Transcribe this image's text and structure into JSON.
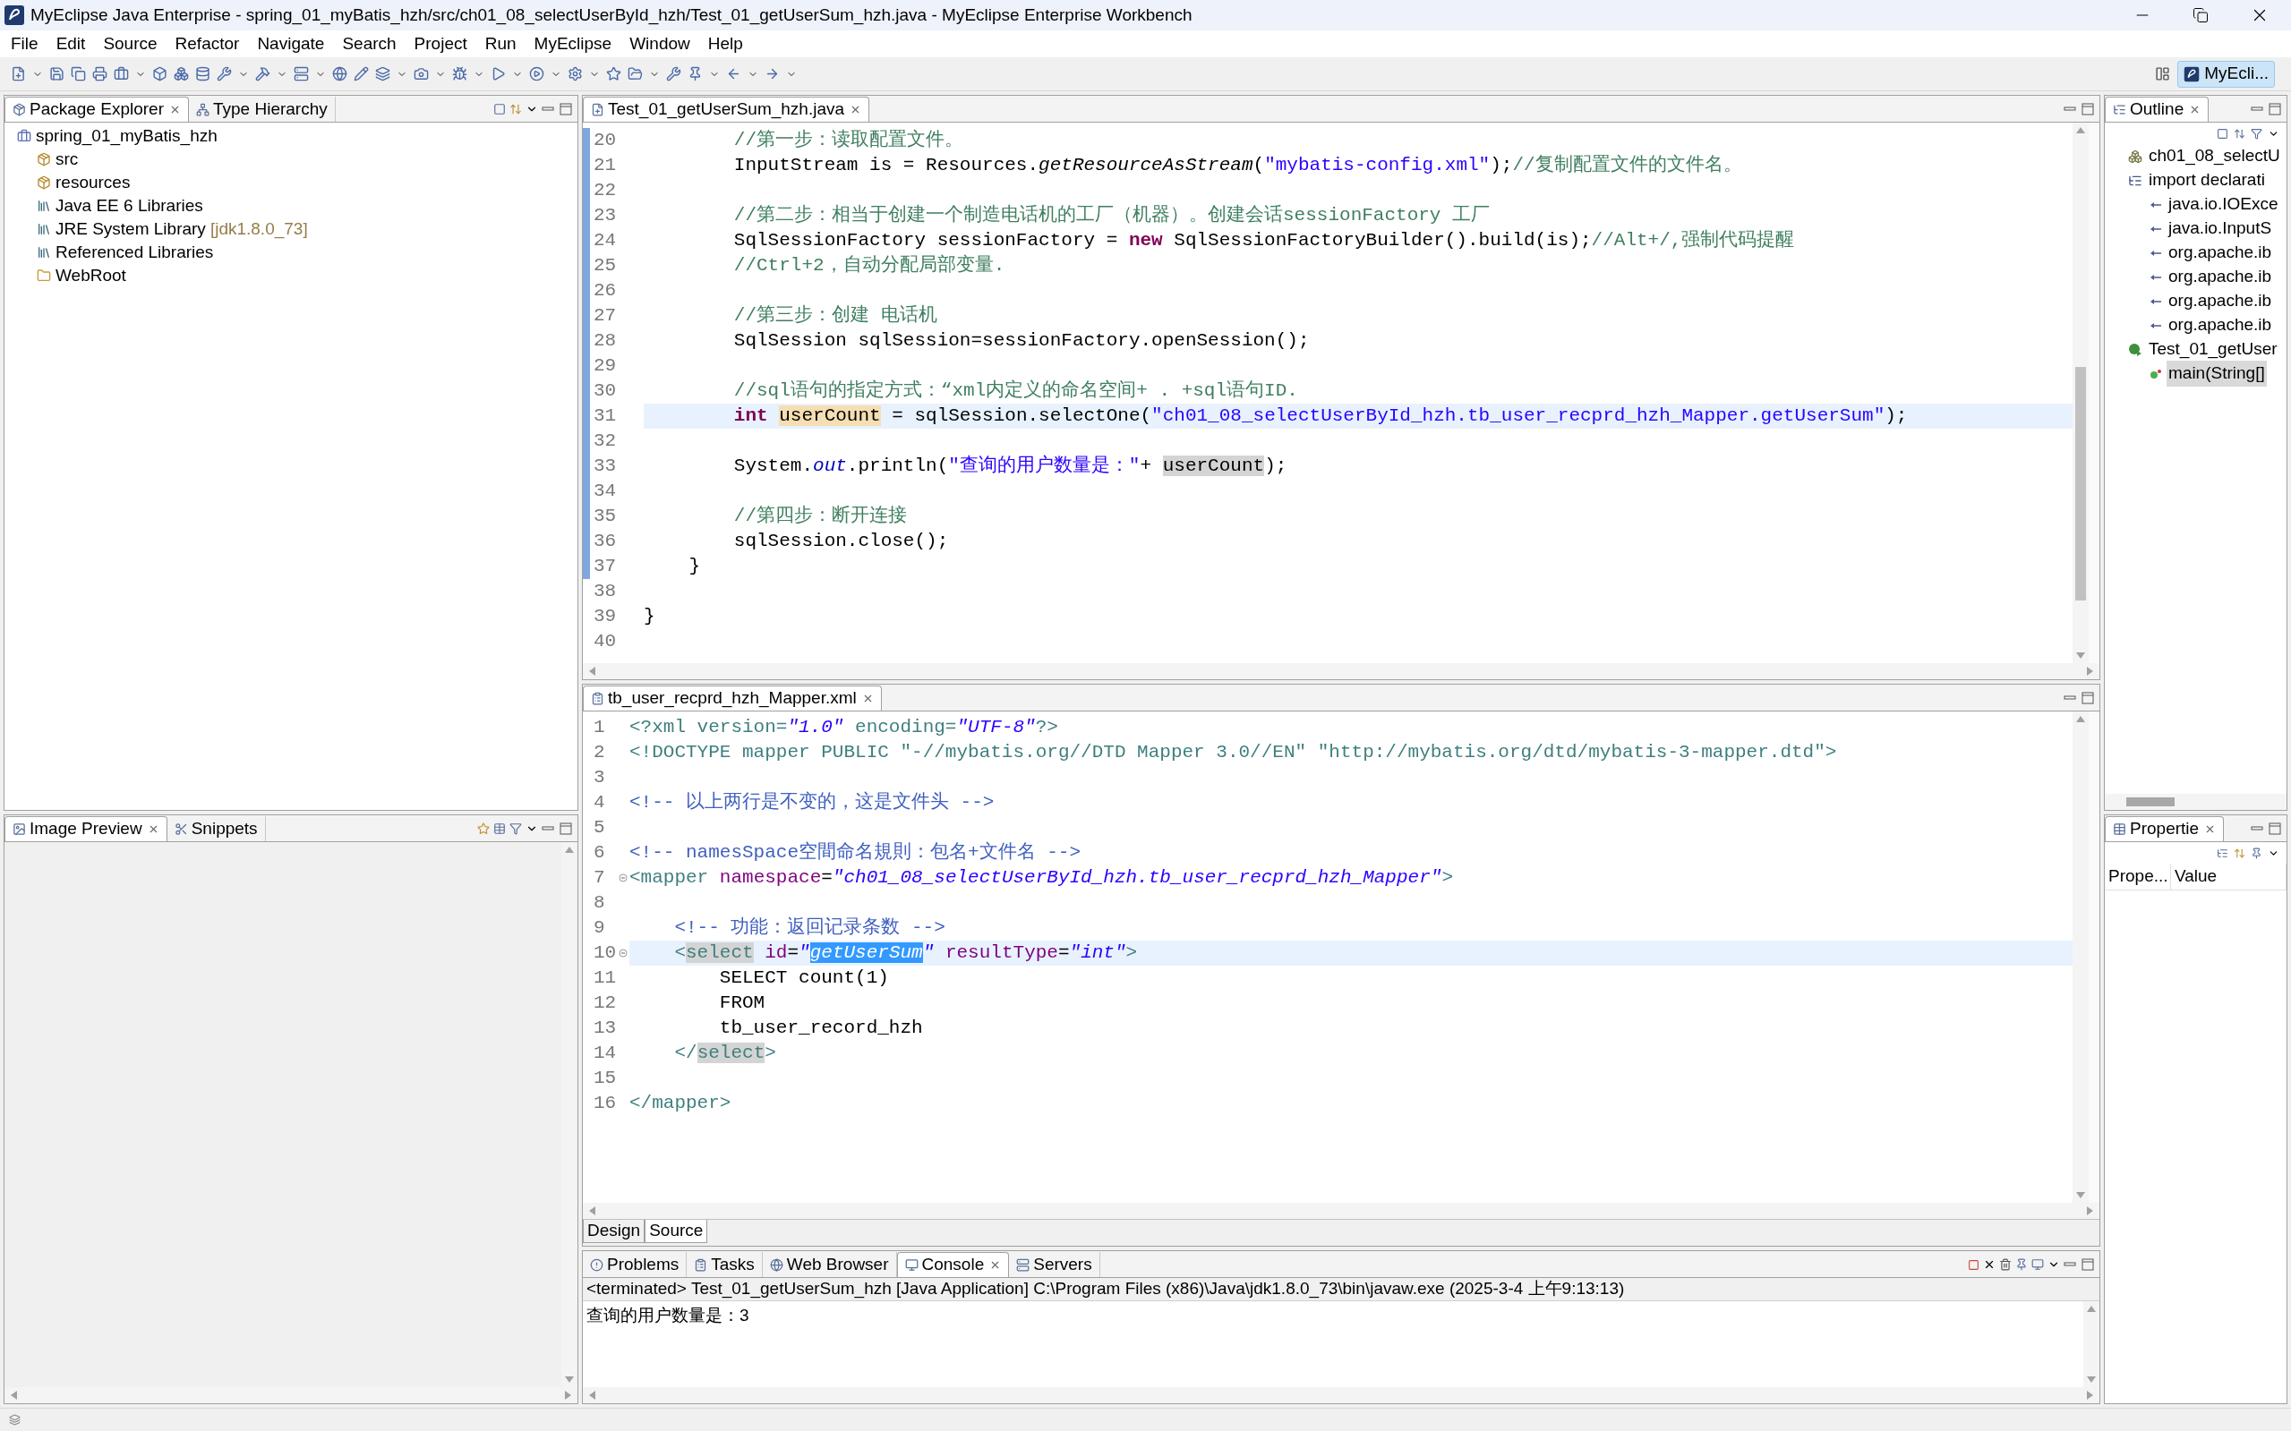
{
  "window": {
    "title": "MyEclipse Java Enterprise - spring_01_myBatis_hzh/src/ch01_08_selectUserById_hzh/Test_01_getUserSum_hzh.java - MyEclipse Enterprise Workbench"
  },
  "menu": [
    "File",
    "Edit",
    "Source",
    "Refactor",
    "Navigate",
    "Search",
    "Project",
    "Run",
    "MyEclipse",
    "Window",
    "Help"
  ],
  "perspective": {
    "label": "MyEcli...",
    "selected": true
  },
  "package_explorer": {
    "tabs": [
      {
        "label": "Package Explorer",
        "selected": true,
        "closable": true
      },
      {
        "label": "Type Hierarchy",
        "selected": false,
        "closable": false
      }
    ],
    "tree": [
      {
        "label": "spring_01_myBatis_hzh",
        "kind": "project",
        "children": [
          {
            "label": "src",
            "kind": "source"
          },
          {
            "label": "resources",
            "kind": "source"
          },
          {
            "label": "Java EE 6 Libraries",
            "kind": "library"
          },
          {
            "label": "JRE System Library",
            "decoration": "[jdk1.8.0_73]",
            "kind": "library"
          },
          {
            "label": "Referenced Libraries",
            "kind": "library"
          },
          {
            "label": "WebRoot",
            "kind": "folder"
          }
        ]
      }
    ]
  },
  "image_preview": {
    "tabs": [
      {
        "label": "Image Preview",
        "selected": true,
        "closable": true
      },
      {
        "label": "Snippets",
        "selected": false,
        "closable": false
      }
    ]
  },
  "java_editor": {
    "tab": {
      "label": "Test_01_getUserSum_hzh.java"
    },
    "lines": [
      {
        "num": "20",
        "current": false,
        "tokens": [
          {
            "t": "        //第一步：读取配置文件。",
            "kind": "comment"
          }
        ]
      },
      {
        "num": "21",
        "current": false,
        "tokens": [
          {
            "t": "        InputStream is = Resources.",
            "kind": "plain"
          },
          {
            "t": "getResourceAsStream",
            "kind": "method"
          },
          {
            "t": "(",
            "kind": "plain"
          },
          {
            "t": "\"mybatis-config.xml\"",
            "kind": "string"
          },
          {
            "t": ");",
            "kind": "plain"
          },
          {
            "t": "//复制配置文件的文件名。",
            "kind": "comment"
          }
        ]
      },
      {
        "num": "22",
        "current": false
      },
      {
        "num": "23",
        "current": false,
        "tokens": [
          {
            "t": "        //第二步：相当于创建一个制造电话机的工厂（机器）。创建会话sessionFactory 工厂",
            "kind": "comment"
          }
        ]
      },
      {
        "num": "24",
        "current": false,
        "tokens": [
          {
            "t": "        SqlSessionFactory sessionFactory = ",
            "kind": "plain"
          },
          {
            "t": "new",
            "kind": "keyword"
          },
          {
            "t": " SqlSessionFactoryBuilder().build(is);",
            "kind": "plain"
          },
          {
            "t": "//Alt+/,强制代码提醒",
            "kind": "comment"
          }
        ]
      },
      {
        "num": "25",
        "current": false,
        "tokens": [
          {
            "t": "        //Ctrl+2，自动分配局部变量.",
            "kind": "comment"
          }
        ]
      },
      {
        "num": "26",
        "current": false
      },
      {
        "num": "27",
        "current": false,
        "tokens": [
          {
            "t": "        //第三步：创建 电话机",
            "kind": "comment"
          }
        ]
      },
      {
        "num": "28",
        "current": false,
        "tokens": [
          {
            "t": "        SqlSession sqlSession=sessionFactory.openSession();",
            "kind": "plain"
          }
        ]
      },
      {
        "num": "29",
        "current": false
      },
      {
        "num": "30",
        "current": false,
        "tokens": [
          {
            "t": "        //sql语句的指定方式：“xml内定义的命名空间+ . +sql语句ID.",
            "kind": "comment"
          }
        ]
      },
      {
        "num": "31",
        "current": true,
        "tokens": [
          {
            "t": "        int ",
            "kind": "keyword"
          },
          {
            "t": "userCount",
            "kind": "occurrence"
          },
          {
            "t": " = sqlSession.selectOne(",
            "kind": "plain"
          },
          {
            "t": "\"ch01_08_selectUserById_hzh.tb_user_recprd_hzh_Mapper.getUserSum\"",
            "kind": "string"
          },
          {
            "t": ");",
            "kind": "plain"
          }
        ]
      },
      {
        "num": "32",
        "current": false
      },
      {
        "num": "33",
        "current": false,
        "tokens": [
          {
            "t": "        System.",
            "kind": "plain"
          },
          {
            "t": "out",
            "kind": "field"
          },
          {
            "t": ".println(",
            "kind": "plain"
          },
          {
            "t": "\"查询的用户数量是：\"",
            "kind": "string"
          },
          {
            "t": "+ ",
            "kind": "plain"
          },
          {
            "t": "userCount",
            "kind": "shade"
          },
          {
            "t": ");",
            "kind": "plain"
          }
        ]
      },
      {
        "num": "34",
        "current": false
      },
      {
        "num": "35",
        "current": false,
        "tokens": [
          {
            "t": "        //第四步：断开连接",
            "kind": "comment"
          }
        ]
      },
      {
        "num": "36",
        "current": false,
        "tokens": [
          {
            "t": "        sqlSession.close();",
            "kind": "plain"
          }
        ]
      },
      {
        "num": "37",
        "current": false,
        "tokens": [
          {
            "t": "    }",
            "kind": "plain"
          }
        ]
      },
      {
        "num": "38",
        "current": false
      },
      {
        "num": "39",
        "current": false,
        "tokens": [
          {
            "t": "}",
            "kind": "plain"
          }
        ]
      },
      {
        "num": "40",
        "current": false
      }
    ]
  },
  "xml_editor": {
    "tab": {
      "label": "tb_user_recprd_hzh_Mapper.xml"
    },
    "lines": [
      {
        "num": "1",
        "current": false,
        "fold": false,
        "tokens": [
          {
            "t": "<?xml version=",
            "kind": "tag"
          },
          {
            "t": "\"1.0\"",
            "kind": "value"
          },
          {
            "t": " encoding=",
            "kind": "tag"
          },
          {
            "t": "\"UTF-8\"",
            "kind": "value"
          },
          {
            "t": "?>",
            "kind": "tag"
          }
        ]
      },
      {
        "num": "2",
        "current": false,
        "fold": false,
        "tokens": [
          {
            "t": "<!DOCTYPE mapper PUBLIC \"-//mybatis.org//DTD Mapper 3.0//EN\" \"http://mybatis.org/dtd/mybatis-3-mapper.dtd\">",
            "kind": "tag"
          }
        ]
      },
      {
        "num": "3",
        "current": false,
        "fold": false
      },
      {
        "num": "4",
        "current": false,
        "fold": false,
        "tokens": [
          {
            "t": "<!-- 以上两行是不变的，这是文件头 -->",
            "kind": "xmlcomment"
          }
        ]
      },
      {
        "num": "5",
        "current": false,
        "fold": false
      },
      {
        "num": "6",
        "current": false,
        "fold": false,
        "tokens": [
          {
            "t": "<!-- namesSpace空間命名規則：包名+文件名 -->",
            "kind": "xmlcomment"
          }
        ]
      },
      {
        "num": "7",
        "current": false,
        "fold": true,
        "tokens": [
          {
            "t": "<mapper",
            "kind": "tag"
          },
          {
            "t": " namespace",
            "kind": "attr"
          },
          {
            "t": "=",
            "kind": "plain"
          },
          {
            "t": "\"ch01_08_selectUserById_hzh.tb_user_recprd_hzh_Mapper\"",
            "kind": "value"
          },
          {
            "t": ">",
            "kind": "tag"
          }
        ]
      },
      {
        "num": "8",
        "current": false,
        "fold": false
      },
      {
        "num": "9",
        "current": false,
        "fold": false,
        "tokens": [
          {
            "t": "    <!-- 功能：返回记录条数 -->",
            "kind": "xmlcomment"
          }
        ]
      },
      {
        "num": "10",
        "current": true,
        "fold": true,
        "tokens": [
          {
            "t": "    <",
            "kind": "tag"
          },
          {
            "t": "select",
            "kind": "shadetag"
          },
          {
            "t": " id",
            "kind": "attr"
          },
          {
            "t": "=",
            "kind": "plain"
          },
          {
            "t": "\"",
            "kind": "value"
          },
          {
            "t": "getUserSum",
            "kind": "selection"
          },
          {
            "t": "\"",
            "kind": "value"
          },
          {
            "t": " resultType",
            "kind": "attr"
          },
          {
            "t": "=",
            "kind": "plain"
          },
          {
            "t": "\"int\"",
            "kind": "value"
          },
          {
            "t": ">",
            "kind": "tag"
          }
        ]
      },
      {
        "num": "11",
        "current": false,
        "fold": false,
        "tokens": [
          {
            "t": "        SELECT count(1)",
            "kind": "plain"
          }
        ]
      },
      {
        "num": "12",
        "current": false,
        "fold": false,
        "tokens": [
          {
            "t": "        FROM",
            "kind": "plain"
          }
        ]
      },
      {
        "num": "13",
        "current": false,
        "fold": false,
        "tokens": [
          {
            "t": "        tb_user_record_hzh",
            "kind": "plain"
          }
        ]
      },
      {
        "num": "14",
        "current": false,
        "fold": false,
        "tokens": [
          {
            "t": "    </",
            "kind": "tag"
          },
          {
            "t": "select",
            "kind": "shadetag"
          },
          {
            "t": ">",
            "kind": "tag"
          }
        ]
      },
      {
        "num": "15",
        "current": false,
        "fold": false
      },
      {
        "num": "16",
        "current": false,
        "fold": false,
        "tokens": [
          {
            "t": "</mapper>",
            "kind": "tag"
          }
        ]
      }
    ],
    "view_tabs": [
      {
        "label": "Design",
        "selected": false
      },
      {
        "label": "Source",
        "selected": true
      }
    ]
  },
  "console": {
    "tabs": [
      {
        "label": "Problems",
        "selected": false,
        "closable": false
      },
      {
        "label": "Tasks",
        "selected": false,
        "closable": false
      },
      {
        "label": "Web Browser",
        "selected": false,
        "closable": false
      },
      {
        "label": "Console",
        "selected": true,
        "closable": true
      },
      {
        "label": "Servers",
        "selected": false,
        "closable": false
      }
    ],
    "header": "<terminated> Test_01_getUserSum_hzh [Java Application] C:\\Program Files (x86)\\Java\\jdk1.8.0_73\\bin\\javaw.exe (2025-3-4 上午9:13:13)",
    "output": "查询的用户数量是：3"
  },
  "outline": {
    "tab": {
      "label": "Outline"
    },
    "tree": [
      {
        "label": "ch01_08_selectU",
        "kind": "package",
        "selected": false
      },
      {
        "label": "import declarati",
        "kind": "imports",
        "selected": false,
        "children": [
          {
            "label": "java.io.IOExce",
            "kind": "import",
            "selected": false
          },
          {
            "label": "java.io.InputS",
            "kind": "import",
            "selected": false
          },
          {
            "label": "org.apache.ib",
            "kind": "import",
            "selected": false
          },
          {
            "label": "org.apache.ib",
            "kind": "import",
            "selected": false
          },
          {
            "label": "org.apache.ib",
            "kind": "import",
            "selected": false
          },
          {
            "label": "org.apache.ib",
            "kind": "import",
            "selected": false
          }
        ]
      },
      {
        "label": "Test_01_getUser",
        "kind": "class",
        "selected": false,
        "children": [
          {
            "label": "main(String[]",
            "kind": "method",
            "selected": true
          }
        ]
      }
    ]
  },
  "properties": {
    "tab": {
      "label": "Propertie"
    },
    "columns": [
      "Prope...",
      "Value"
    ]
  }
}
